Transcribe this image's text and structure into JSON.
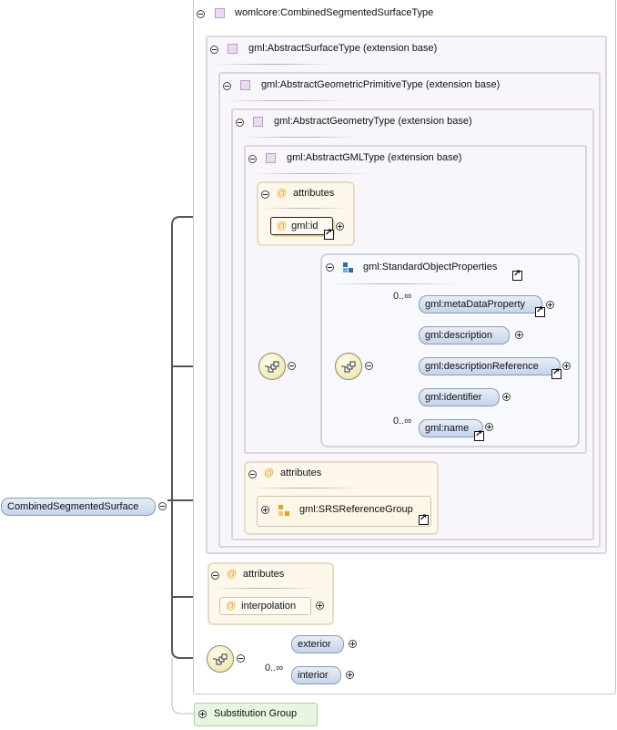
{
  "root": {
    "label": "CombinedSegmentedSurface"
  },
  "outer_type": {
    "label": "womlcore:CombinedSegmentedSurfaceType"
  },
  "extensions": [
    {
      "label": "gml:AbstractSurfaceType (extension base)"
    },
    {
      "label": "gml:AbstractGeometricPrimitiveType (extension base)"
    },
    {
      "label": "gml:AbstractGeometryType (extension base)"
    },
    {
      "label": "gml:AbstractGMLType (extension base)"
    }
  ],
  "gml_attributes": {
    "title": "attributes",
    "items": [
      {
        "label": "gml:id"
      }
    ]
  },
  "standard_object_properties": {
    "group_label": "gml:StandardObjectProperties",
    "elements": [
      {
        "label": "gml:metaDataProperty",
        "cardinality": "0..∞"
      },
      {
        "label": "gml:description",
        "cardinality": ""
      },
      {
        "label": "gml:descriptionReference",
        "cardinality": ""
      },
      {
        "label": "gml:identifier",
        "cardinality": ""
      },
      {
        "label": "gml:name",
        "cardinality": "0..∞"
      }
    ]
  },
  "srs_attributes": {
    "title": "attributes",
    "group": "gml:SRSReferenceGroup"
  },
  "type_attributes": {
    "title": "attributes",
    "items": [
      {
        "label": "interpolation"
      }
    ]
  },
  "sequence": {
    "elements": [
      {
        "label": "exterior",
        "cardinality": ""
      },
      {
        "label": "interior",
        "cardinality": "0..∞"
      }
    ]
  },
  "substitution_group": {
    "label": "Substitution Group"
  },
  "colors": {
    "connector": "#555555",
    "element_fill": "#c6d4ea",
    "attribute_accent": "#e8a21c",
    "type_icon": "#eadbf0",
    "substitution_fill": "#e6f6e1"
  }
}
